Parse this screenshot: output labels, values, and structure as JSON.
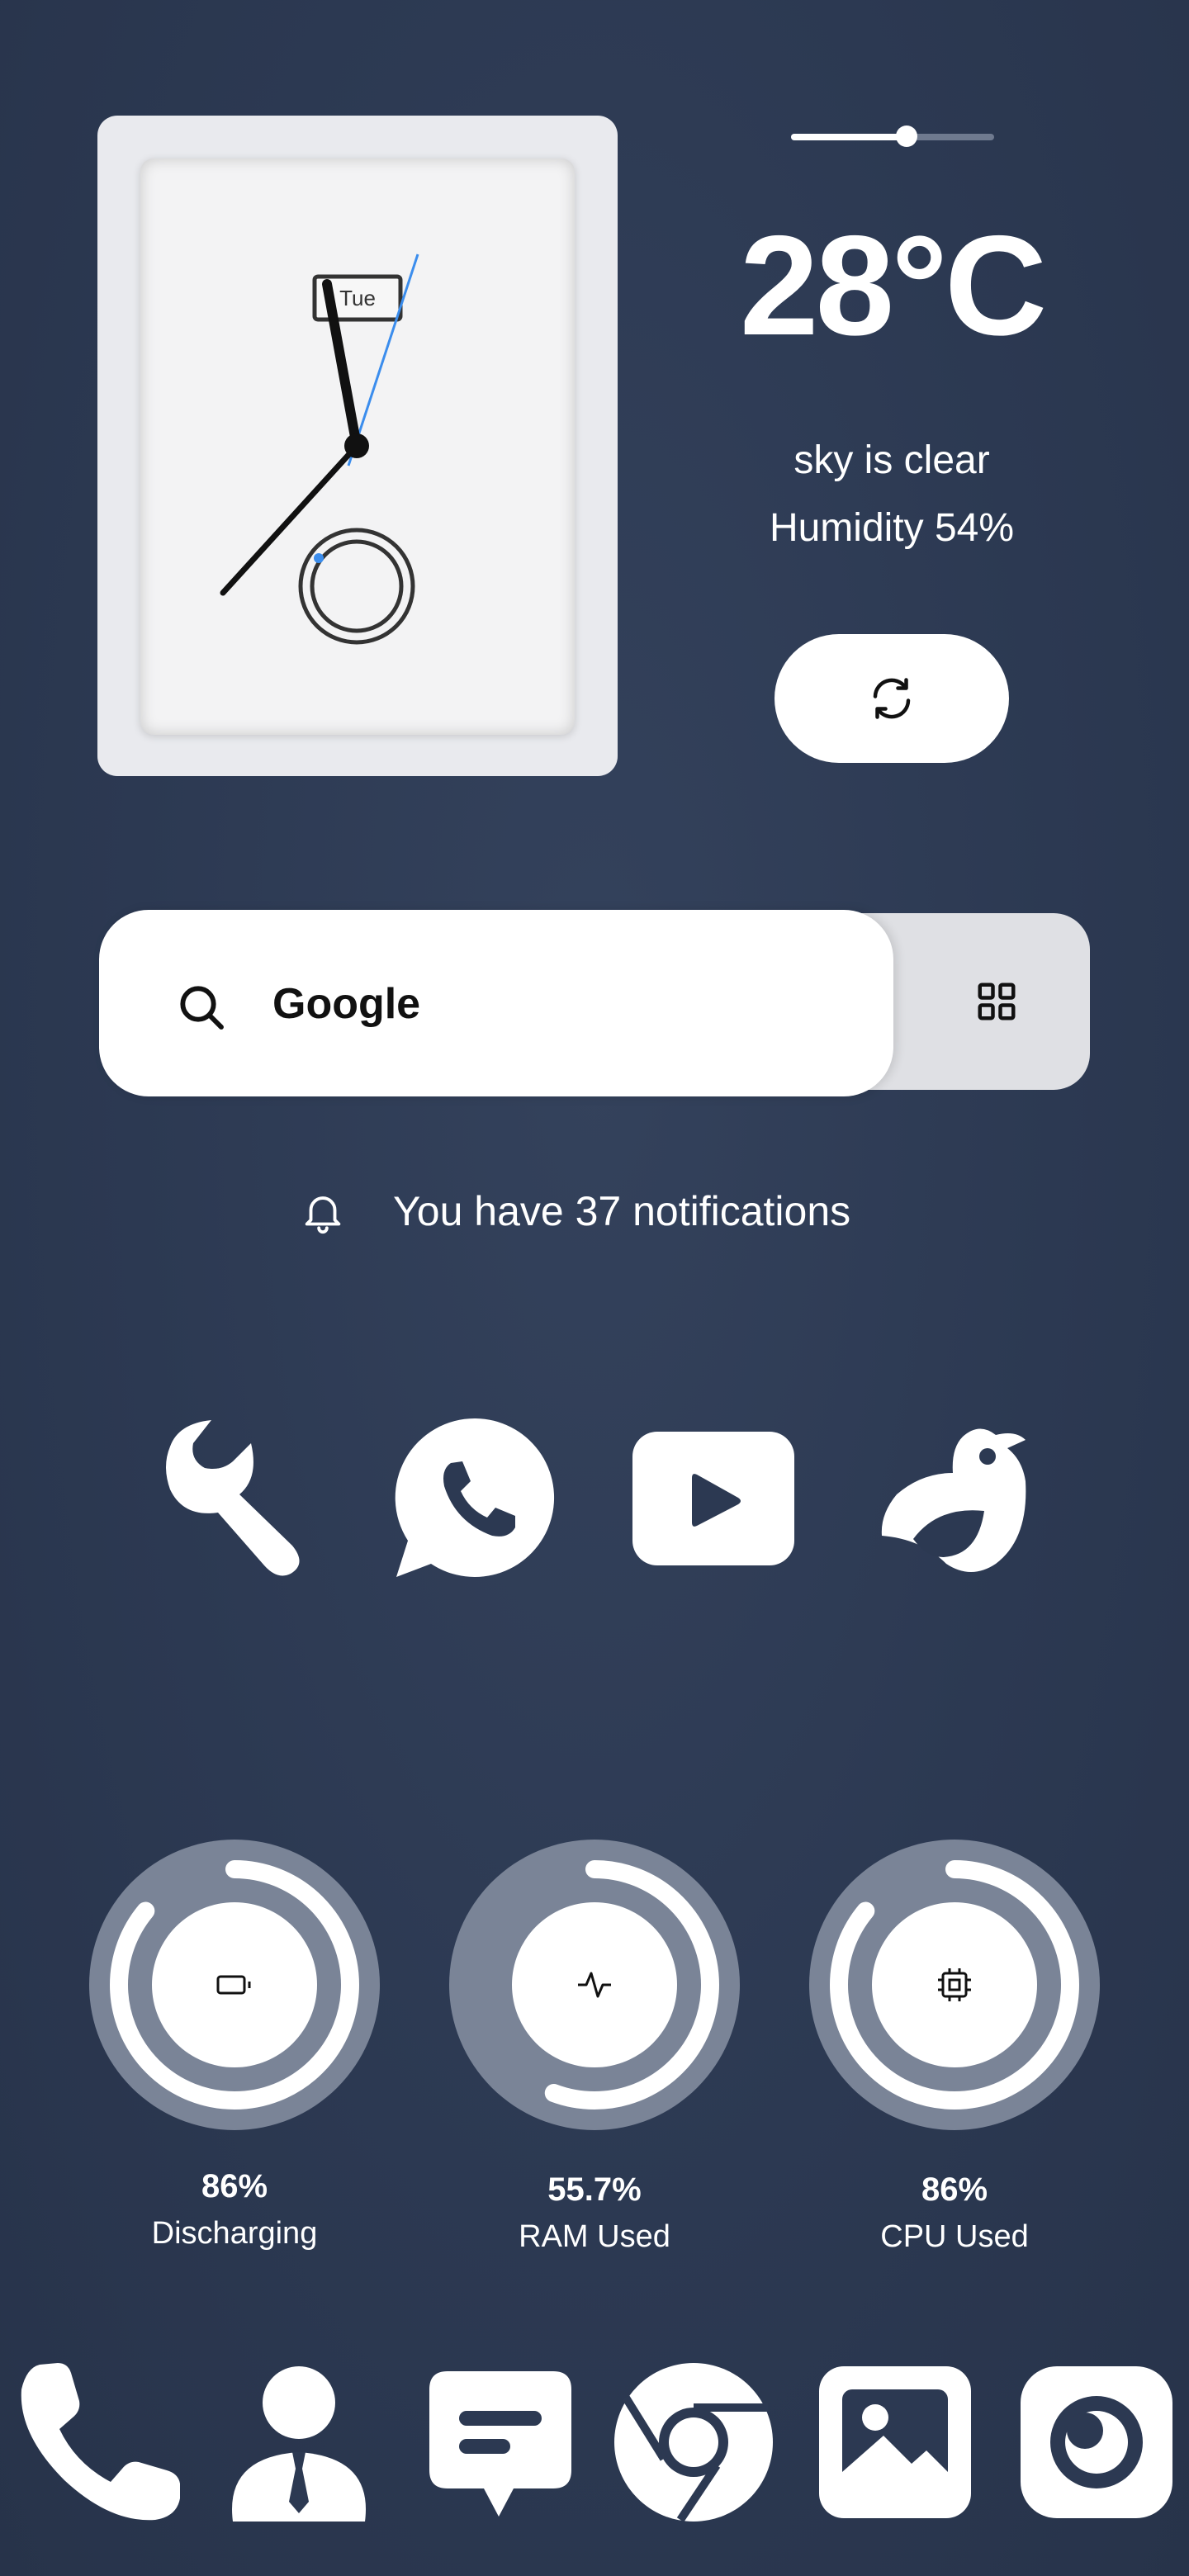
{
  "clock": {
    "day": "Tue"
  },
  "weather": {
    "temperature": "28°C",
    "condition": "sky is clear",
    "humidity": "Humidity 54%",
    "brightness_level": 0.57
  },
  "search": {
    "label": "Google"
  },
  "notifications": {
    "text": "You have 37 notifications"
  },
  "apps": [
    {
      "name": "Tools",
      "icon": "wrench-icon"
    },
    {
      "name": "WhatsApp",
      "icon": "whatsapp-icon"
    },
    {
      "name": "YouTube",
      "icon": "youtube-icon"
    },
    {
      "name": "Bird",
      "icon": "bird-icon"
    }
  ],
  "stats": [
    {
      "value": "86%",
      "label": "Discharging",
      "icon": "battery-icon",
      "fraction": 0.86
    },
    {
      "value": "55.7%",
      "label": "RAM Used",
      "icon": "activity-icon",
      "fraction": 0.557
    },
    {
      "value": "86%",
      "label": "CPU Used",
      "icon": "cpu-icon",
      "fraction": 0.86
    }
  ],
  "dock": [
    {
      "icon": "phone-icon"
    },
    {
      "icon": "contacts-icon"
    },
    {
      "icon": "messages-icon"
    },
    {
      "icon": "chrome-icon"
    },
    {
      "icon": "gallery-icon"
    },
    {
      "icon": "camera-icon"
    }
  ],
  "colors": {
    "background": "#2c3952",
    "accent": "#3b8ded",
    "widget": "#e9eaee"
  }
}
